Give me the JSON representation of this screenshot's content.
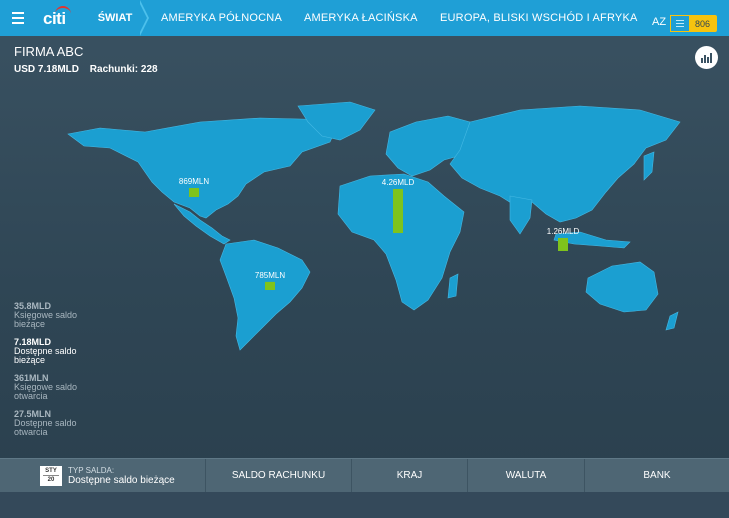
{
  "nav": {
    "logo": "citi",
    "active_tab": "ŚWIAT",
    "tabs": [
      "AMERYKA PÓŁNOCNA",
      "AMERYKA ŁACIŃSKA",
      "EUROPA, BLISKI WSCHÓD I AFRYKA"
    ],
    "region_short": "AZ",
    "badge_count": "806"
  },
  "header": {
    "title": "FIRMA ABC",
    "amount": "USD 7.18MLD",
    "accounts": "Rachunki: 228"
  },
  "map_bars": [
    {
      "label": "869MLN",
      "value": 0.869,
      "region": "north-america"
    },
    {
      "label": "4.26MLD",
      "value": 4.26,
      "region": "emea"
    },
    {
      "label": "1.26MLD",
      "value": 1.26,
      "region": "asia"
    },
    {
      "label": "785MLN",
      "value": 0.785,
      "region": "latin-america"
    }
  ],
  "stats": [
    {
      "value": "35.8MLD",
      "label": "Księgowe saldo bieżące",
      "active": false
    },
    {
      "value": "7.18MLD",
      "label": "Dostępne saldo bieżące",
      "active": true
    },
    {
      "value": "361MLN",
      "label": "Księgowe saldo otwarcia",
      "active": false
    },
    {
      "value": "27.5MLN",
      "label": "Dostępne saldo otwarcia",
      "active": false
    }
  ],
  "bottom": {
    "cal_month": "STY",
    "cal_day": "20",
    "balance_type_label": "TYP SALDA:",
    "balance_type_value": "Dostępne saldo bieżące",
    "account_balance": "SALDO RACHUNKU",
    "country": "KRAJ",
    "currency": "WALUTA",
    "bank": "BANK"
  },
  "colors": {
    "nav_blue": "#1f9fd6",
    "map_land": "#1b9fd1",
    "bar_green": "#7fc31c",
    "badge_yellow": "#f7c30e"
  }
}
